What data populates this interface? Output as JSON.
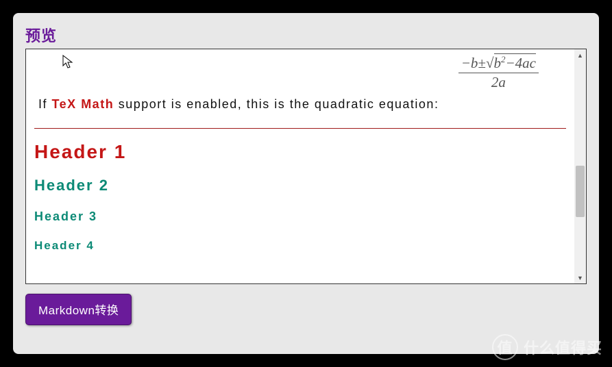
{
  "panel": {
    "title": "预览"
  },
  "formula": {
    "numerator_prefix": "−b±",
    "sqrt_sym": "√",
    "under_sqrt_base": "b",
    "under_sqrt_exp": "2",
    "under_sqrt_tail": "−4ac",
    "denominator": "2a"
  },
  "description": {
    "prefix": "If ",
    "tex_label": "TeX Math",
    "suffix": " support is enabled, this is the quadratic equation:"
  },
  "headers": {
    "h1": "Header 1",
    "h2": "Header 2",
    "h3": "Header 3",
    "h4": "Header 4"
  },
  "button": {
    "label": "Markdown转换"
  },
  "scroll": {
    "up": "▲",
    "down": "▼"
  },
  "watermark": {
    "badge": "值",
    "text": "什么值得买"
  }
}
